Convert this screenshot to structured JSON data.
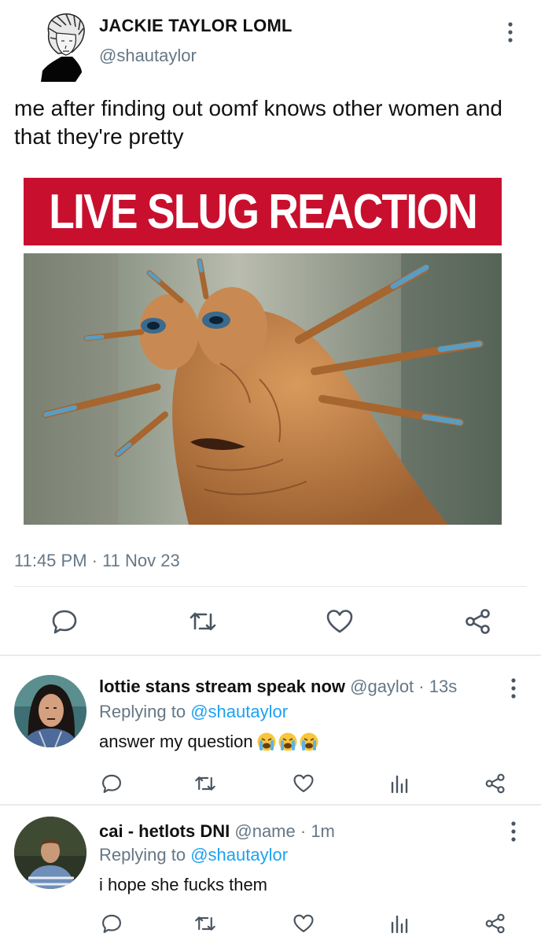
{
  "tweet": {
    "author_name": "JACKIE TAYLOR LOML",
    "author_handle": "@shautaylor",
    "text": "me after finding out oomf knows other women and that they're pretty",
    "image_banner": "LIVE SLUG REACTION",
    "timestamp": "11:45 PM · 11 Nov 23",
    "actions": [
      "reply-icon",
      "retweet-icon",
      "like-icon",
      "share-icon"
    ]
  },
  "replies": [
    {
      "name": "lottie stans stream speak now",
      "handle": "@gaylot",
      "time": "· 13s",
      "replying_label": "Replying to",
      "replying_to": "@shautaylor",
      "text": "answer my question",
      "emoji": [
        "loudly-crying-face",
        "loudly-crying-face",
        "loudly-crying-face"
      ]
    },
    {
      "name": "cai - hetlots DNI",
      "handle": "@name",
      "time": "· 1m",
      "replying_label": "Replying to",
      "replying_to": "@shautaylor",
      "text": "i hope she fucks them"
    }
  ],
  "colors": {
    "accent": "#1da1f2",
    "muted_text": "#657786",
    "icon": "#4a5560",
    "banner_red": "#c8102e"
  }
}
